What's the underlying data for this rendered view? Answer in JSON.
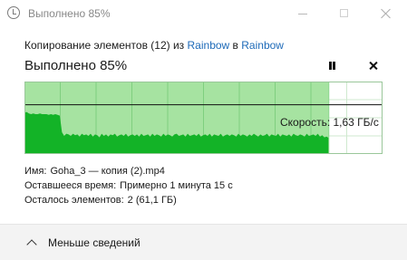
{
  "window": {
    "title": "Выполнено 85%",
    "icon": "checkmark-circle-icon"
  },
  "copy_line": {
    "prefix": "Копирование элементов (12) из ",
    "source": "Rainbow",
    "middle": " в ",
    "destination": "Rainbow"
  },
  "progress": {
    "heading": "Выполнено 85%",
    "percent": 85,
    "pause_icon": "pause-icon",
    "cancel_icon": "close-icon"
  },
  "graph": {
    "speed_label": "Скорость: 1,63 ГБ/с",
    "colors": {
      "progress_fill": "#a6e3a1",
      "remaining_fill": "#ffffff",
      "throughput_fill": "#13b327",
      "grid": "#7fcf7f",
      "border": "#9ac79a",
      "speed_line": "#111111"
    },
    "speed_level_fraction": 0.68,
    "throughput": [
      0.57,
      0.58,
      0.56,
      0.55,
      0.56,
      0.55,
      0.55,
      0.56,
      0.55,
      0.55,
      0.55,
      0.54,
      0.55,
      0.54,
      0.55,
      0.54,
      0.53,
      0.3,
      0.25,
      0.28,
      0.27,
      0.25,
      0.28,
      0.26,
      0.27,
      0.24,
      0.28,
      0.26,
      0.27,
      0.25,
      0.28,
      0.24,
      0.27,
      0.26,
      0.23,
      0.28,
      0.25,
      0.27,
      0.24,
      0.27,
      0.26,
      0.28,
      0.24,
      0.26,
      0.27,
      0.25,
      0.28,
      0.24,
      0.26,
      0.27,
      0.25,
      0.27,
      0.24,
      0.28,
      0.25,
      0.26,
      0.27,
      0.24,
      0.28,
      0.25,
      0.27,
      0.26,
      0.24,
      0.28,
      0.25,
      0.27,
      0.26,
      0.24,
      0.27,
      0.28,
      0.25,
      0.26,
      0.27,
      0.24,
      0.28,
      0.25,
      0.26,
      0.27,
      0.25,
      0.28,
      0.24,
      0.26,
      0.27,
      0.25,
      0.28,
      0.24,
      0.27,
      0.26,
      0.25,
      0.28,
      0.24,
      0.26,
      0.27,
      0.25,
      0.27,
      0.26,
      0.24,
      0.28,
      0.25,
      0.27,
      0.26,
      0.24,
      0.27,
      0.25,
      0.28,
      0.26,
      0.24,
      0.27,
      0.25,
      0.26,
      0.28,
      0.24,
      0.27,
      0.26,
      0.25,
      0.28,
      0.24,
      0.27,
      0.26,
      0.25,
      0.27,
      0.24,
      0.28,
      0.26,
      0.25,
      0.27,
      0.26,
      0.24,
      0.28,
      0.25,
      0.26,
      0.27,
      0.25,
      0.28,
      0.24,
      0.26,
      0.23,
      0.24,
      0.22
    ]
  },
  "details": [
    {
      "key": "Имя:",
      "value": "Goha_3 — копия (2).mp4"
    },
    {
      "key": "Оставшееся время:",
      "value": "Примерно 1 минута 15 с"
    },
    {
      "key": "Осталось элементов:",
      "value": "2 (61,1 ГБ)"
    }
  ],
  "footer": {
    "less_details_label": "Меньше сведений",
    "chevron_icon": "chevron-up-icon"
  }
}
